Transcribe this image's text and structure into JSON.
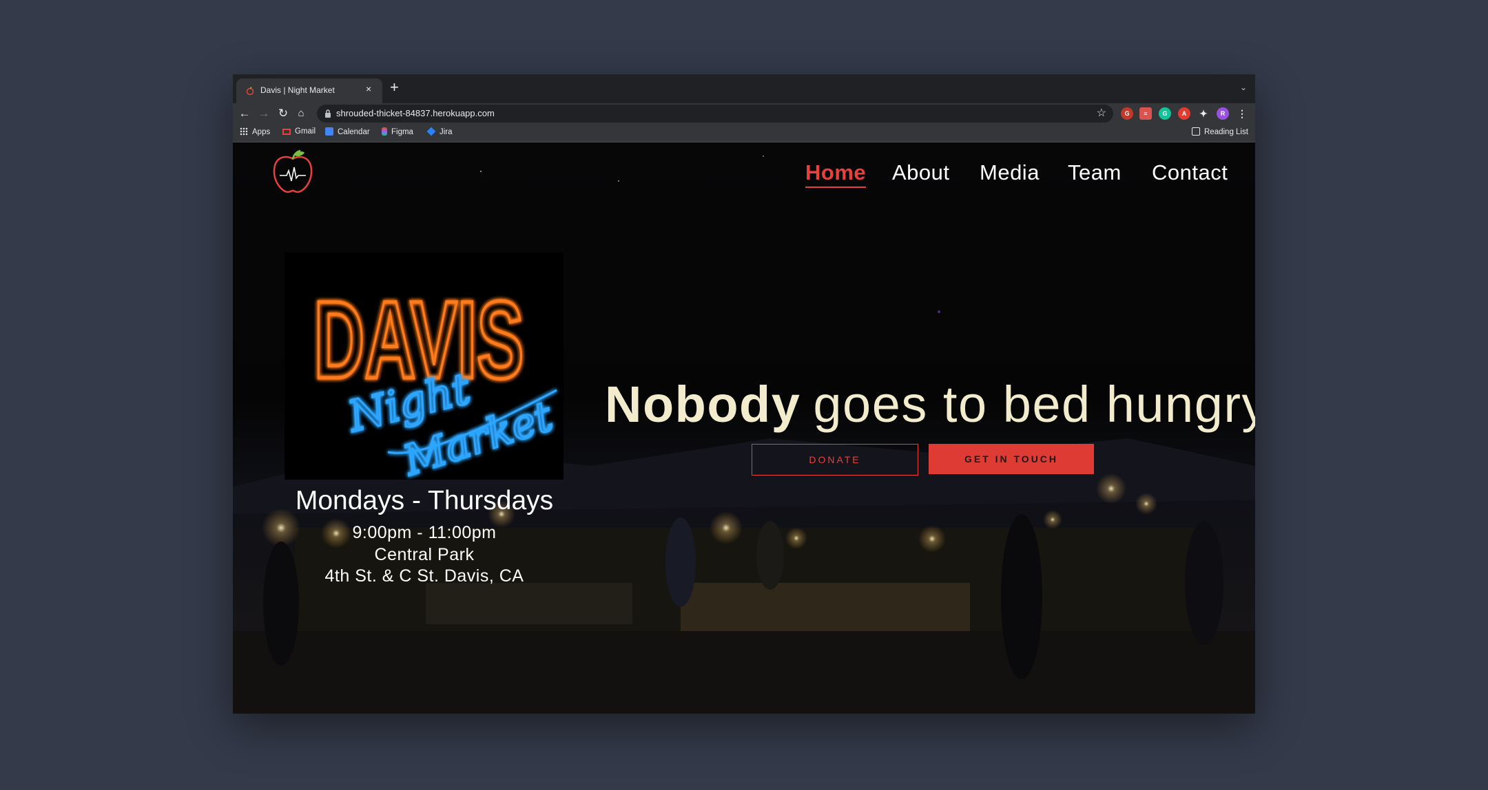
{
  "browser": {
    "tab_title": "Davis | Night Market",
    "tab_close": "×",
    "new_tab": "+",
    "url": "shrouded-thicket-84837.herokuapp.com",
    "bookmarks": [
      "Apps",
      "Gmail",
      "Calendar",
      "Figma",
      "Jira"
    ],
    "reading_list": "Reading List",
    "profile_initial": "R"
  },
  "nav": {
    "items": [
      "Home",
      "About",
      "Media",
      "Team",
      "Contact"
    ],
    "active": "Home"
  },
  "hero": {
    "neon_line1": "DAVIS",
    "neon_line2": "Night",
    "neon_line3": "Market",
    "days": "Mondays - Thursdays",
    "time": "9:00pm - 11:00pm",
    "location": "Central Park",
    "address": "4th St. & C St. Davis, CA",
    "headline_bold": "Nobody",
    "headline_rest": "goes to bed hungry.",
    "donate_label": "DONATE",
    "contact_label": "GET IN TOUCH"
  },
  "colors": {
    "accent": "#e8413b",
    "headline": "#f2eccc",
    "neon_orange": "#ff7a1a",
    "neon_blue": "#2ea6ff"
  }
}
